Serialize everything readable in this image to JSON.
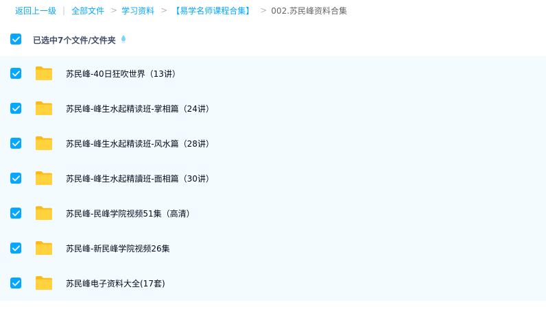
{
  "breadcrumb": {
    "back": "返回上一级",
    "items": [
      "全部文件",
      "学习资料",
      "【易学名师课程合集】"
    ],
    "current": "002.苏民峰资料合集"
  },
  "selection": {
    "summary": "已选中7个文件/文件夹"
  },
  "files": [
    {
      "name": "苏民峰-40日狂吹世界（13讲）",
      "checked": true
    },
    {
      "name": "苏民峰-峰生水起精读班-掌相篇（24讲）",
      "checked": true
    },
    {
      "name": "苏民峰-峰生水起精读班-风水篇（28讲）",
      "checked": true
    },
    {
      "name": "苏民峰-峰生水起精讀班-面相篇（30讲）",
      "checked": true
    },
    {
      "name": "苏民峰-民峰学院视频51集（高清）",
      "checked": true
    },
    {
      "name": "苏民峰-新民峰学院视频26集",
      "checked": true
    },
    {
      "name": "苏民峰电子资料大全(17套)",
      "checked": true
    }
  ],
  "icons": {
    "checkbox": "checkmark-icon",
    "folder": "folder-icon",
    "tip": "droplet-tip-icon"
  },
  "colors": {
    "accent": "#06a7ff",
    "folder": "#ffc41f",
    "list_background": "#f4fbff",
    "text": "#03081a"
  }
}
